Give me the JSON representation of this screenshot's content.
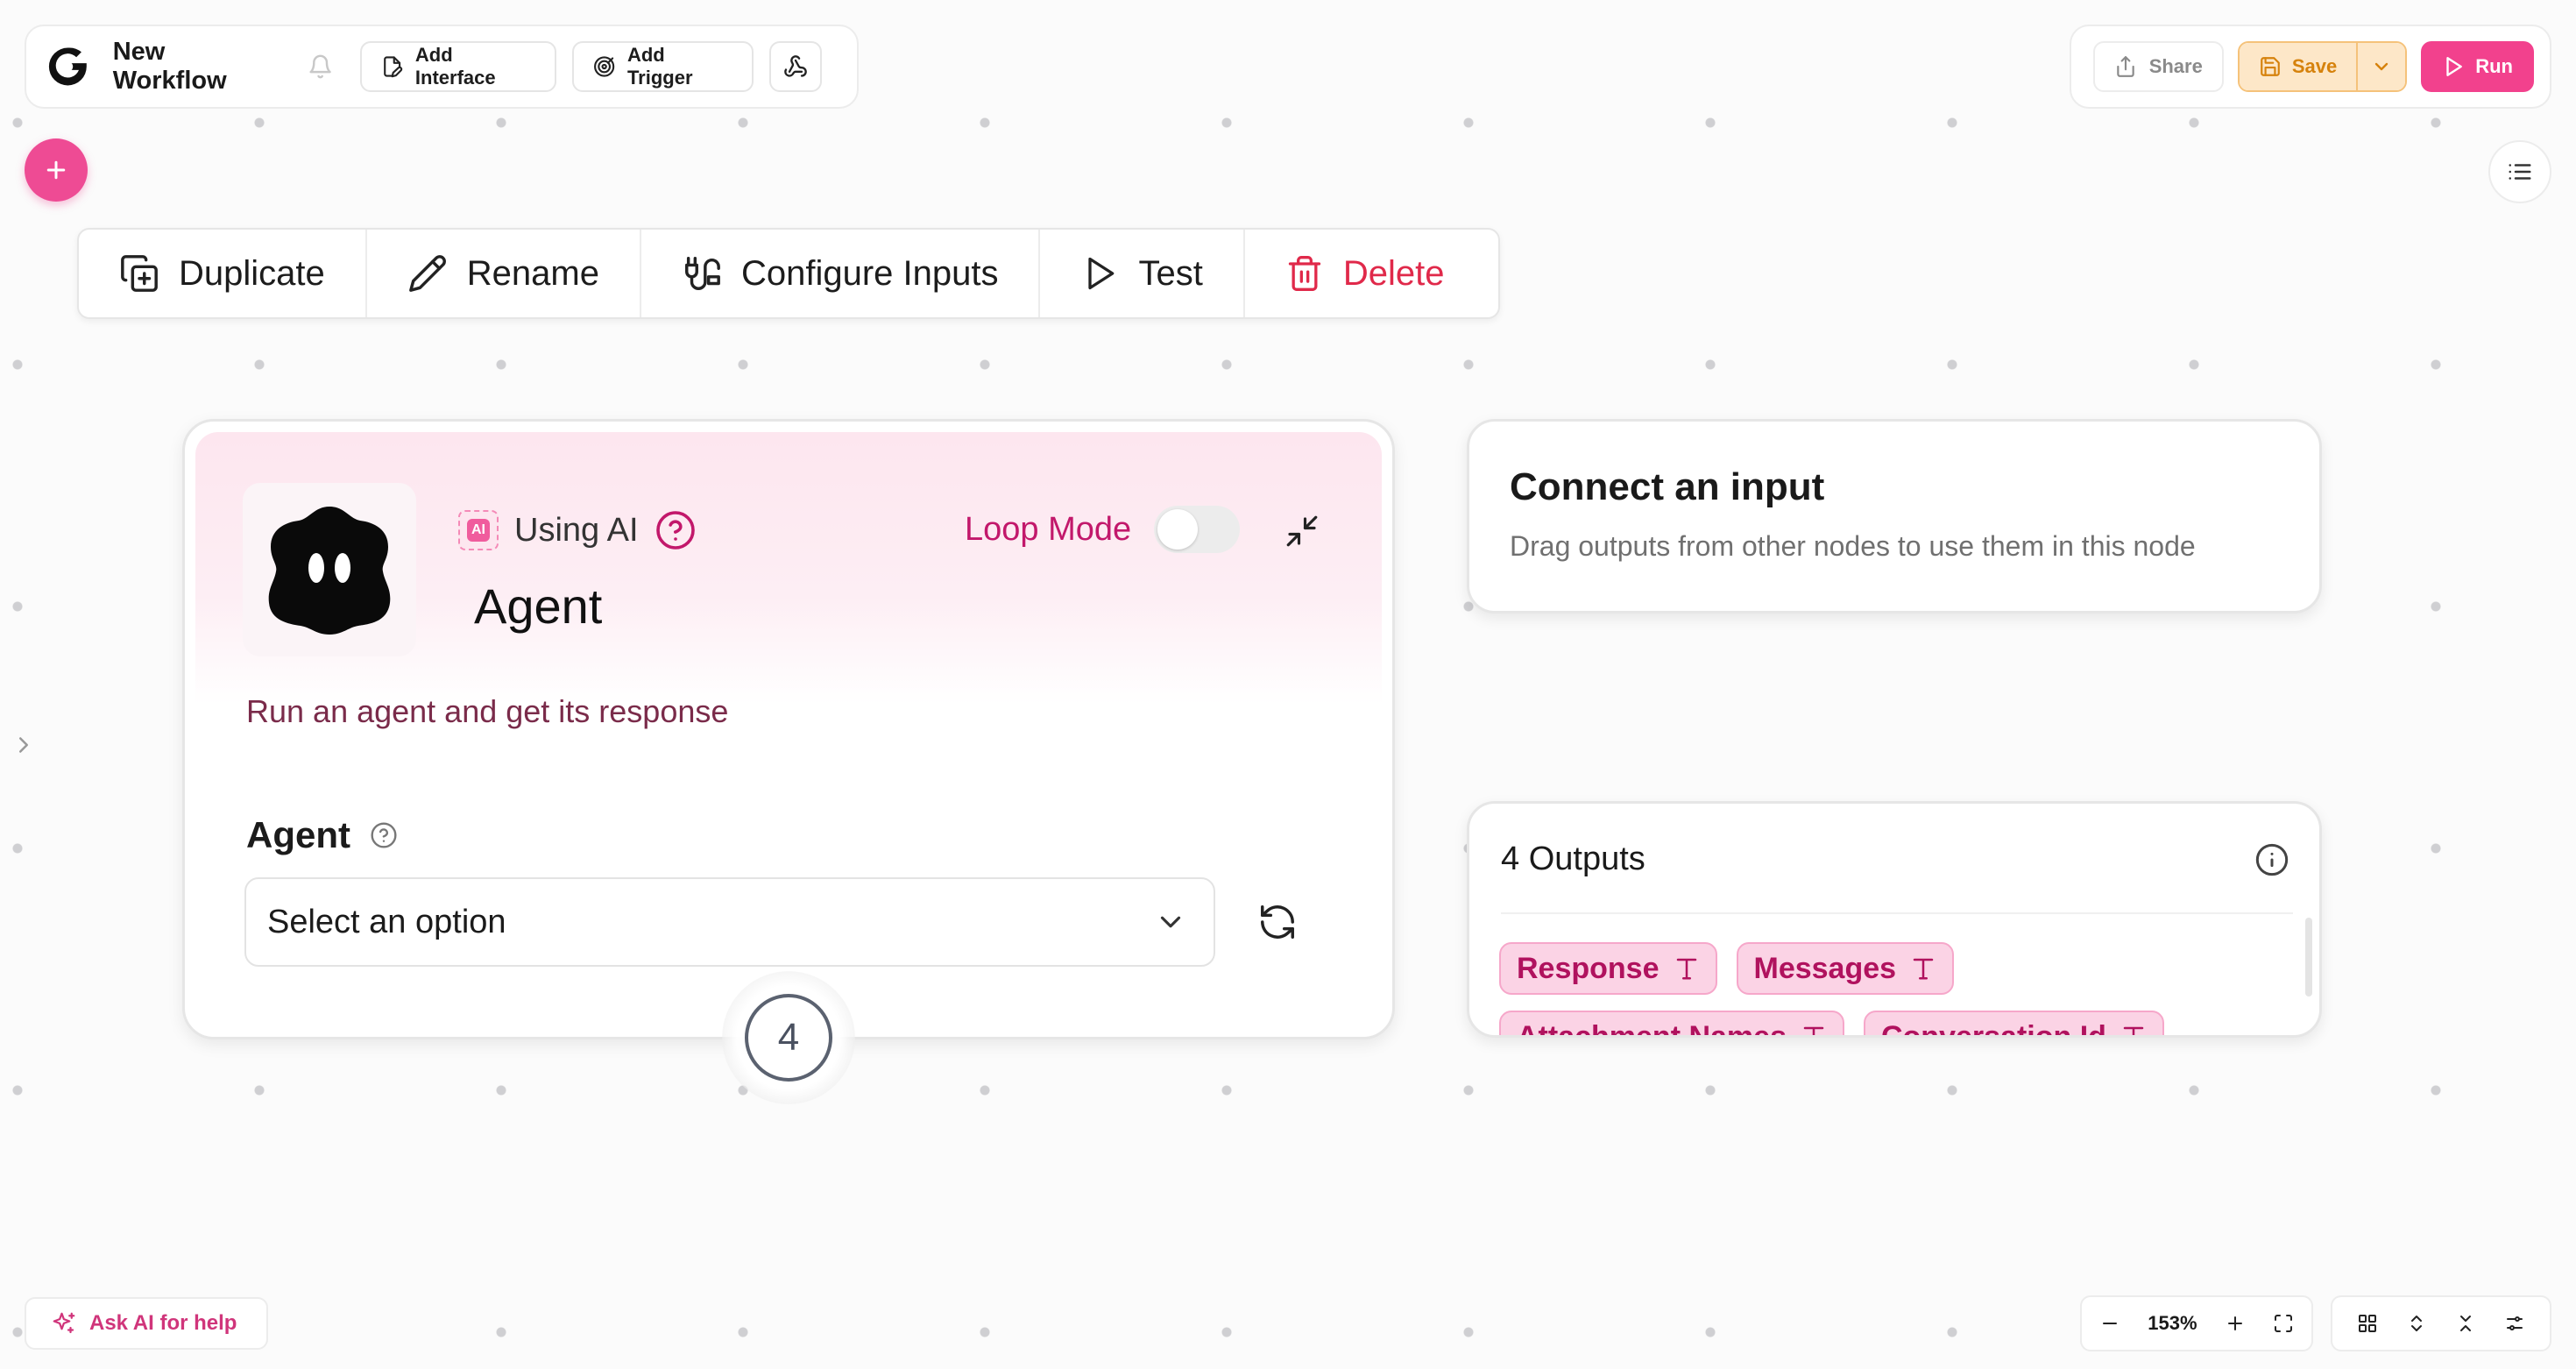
{
  "header": {
    "workflow_title": "New Workflow",
    "add_interface_label": "Add Interface",
    "add_trigger_label": "Add Trigger",
    "share_label": "Share",
    "save_label": "Save",
    "run_label": "Run"
  },
  "node_toolbar": {
    "duplicate_label": "Duplicate",
    "rename_label": "Rename",
    "configure_inputs_label": "Configure Inputs",
    "test_label": "Test",
    "delete_label": "Delete"
  },
  "agent_node": {
    "ai_chip_text": "AI",
    "using_ai_label": "Using AI",
    "title": "Agent",
    "loop_mode_label": "Loop Mode",
    "loop_mode_on": false,
    "description": "Run an agent and get its response",
    "field_label": "Agent",
    "select_placeholder": "Select an option",
    "badge_count": "4"
  },
  "connect_card": {
    "title": "Connect an input",
    "description": "Drag outputs from other nodes to use them in this node"
  },
  "outputs_card": {
    "title": "4 Outputs",
    "outputs": [
      {
        "label": "Response",
        "type_icon": "text-type-icon"
      },
      {
        "label": "Messages",
        "type_icon": "text-type-icon"
      },
      {
        "label": "Attachment Names",
        "type_icon": "text-type-icon"
      },
      {
        "label": "Conversation Id",
        "type_icon": "text-type-icon"
      }
    ]
  },
  "footer": {
    "ask_ai_label": "Ask AI for help",
    "zoom_level": "153%"
  },
  "colors": {
    "brand_pink": "#ee4b94",
    "loop_label": "#c2186b",
    "save_orange": "#d6820c",
    "delete_red": "#e0294a"
  }
}
